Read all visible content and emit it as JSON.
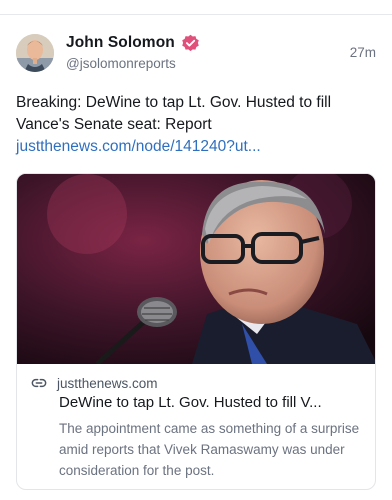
{
  "post": {
    "author_name": "John Solomon",
    "author_handle": "@jsolomonreports",
    "timestamp": "27m",
    "verified": true,
    "avatar_icon": "user-avatar-photo",
    "text": "Breaking: DeWine to tap Lt. Gov. Husted to fill Vance's Senate seat: Report",
    "link_text": "justthenews.com/node/141240?ut..."
  },
  "link_card": {
    "domain": "justthenews.com",
    "title": "DeWine to tap Lt. Gov. Husted to fill V...",
    "description": "The appointment came as something of a surprise amid reports that Vivek Ramaswamy was under consideration for the post.",
    "image_icon": "news-photo",
    "link_icon": "link-icon"
  },
  "colors": {
    "link": "#2f6fbf",
    "verified_badge": "#e0507a",
    "muted_text": "#6b7280"
  }
}
